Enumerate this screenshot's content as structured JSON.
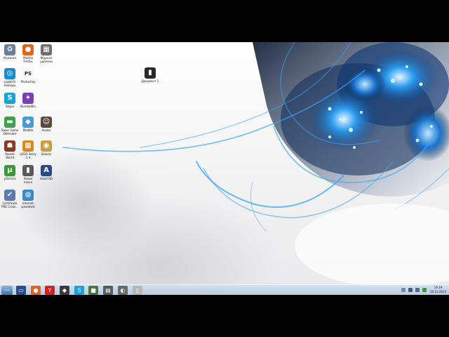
{
  "desktop": {
    "icons": [
      {
        "name": "icon-1-1",
        "label": "Корзина",
        "color": "#6a7fa0",
        "glyph": "♻"
      },
      {
        "name": "icon-1-2",
        "label": "Mozilla Firefox",
        "color": "#e0641e",
        "glyph": "●"
      },
      {
        "name": "icon-1-3",
        "label": "Журнал удалени",
        "color": "#6e6e6e",
        "glyph": "▦"
      },
      {
        "name": "icon-2-1",
        "label": "Logitech Камеры",
        "color": "#1a8ad6",
        "glyph": "◎"
      },
      {
        "name": "icon-2-2",
        "label": "Photoshop",
        "color": "#ffffff",
        "glyph": "PS"
      },
      {
        "name": "icon-3-1",
        "label": "Skype",
        "color": "#1aa1e0",
        "glyph": "S"
      },
      {
        "name": "icon-3-2",
        "label": "NumbaWin",
        "color": "#7a3fb5",
        "glyph": "✦"
      },
      {
        "name": "icon-4-1",
        "label": "Tower Game Defender",
        "color": "#3fa04a",
        "glyph": "▬"
      },
      {
        "name": "icon-4-2",
        "label": "ModMe",
        "color": "#4a9ad6",
        "glyph": "◆"
      },
      {
        "name": "icon-4-3",
        "label": "Avatar",
        "color": "#5a4a3a",
        "glyph": "☺"
      },
      {
        "name": "icon-5-1",
        "label": "Rocket World",
        "color": "#8a3a20",
        "glyph": "☗"
      },
      {
        "name": "icon-5-2",
        "label": "LEGO Harry 1-4",
        "color": "#d88a18",
        "glyph": "▩"
      },
      {
        "name": "icon-5-3",
        "label": "Selectu",
        "color": "#c8a040",
        "glyph": "◉"
      },
      {
        "name": "icon-6-1",
        "label": "µTorrent",
        "color": "#3a9a3a",
        "glyph": "µ"
      },
      {
        "name": "icon-6-2",
        "label": "Новая папка",
        "color": "#5a5a5a",
        "glyph": "▮"
      },
      {
        "name": "icon-6-3",
        "label": "AutoCAD",
        "color": "#2a4a8a",
        "glyph": "A"
      },
      {
        "name": "icon-7-1",
        "label": "Certificate PRE Creat...",
        "color": "#5a7ab0",
        "glyph": "✔"
      },
      {
        "name": "icon-7-2",
        "label": "Internet speedtest",
        "color": "#3a8ac8",
        "glyph": "◍"
      },
      {
        "name": "icon-file",
        "label": "Документ 1",
        "color": "#2a2a2a",
        "glyph": "▮"
      }
    ]
  },
  "taskbar": {
    "start_label": "Пуск",
    "items": [
      {
        "name": "taskbar-monitor",
        "color": "#2a4a8a",
        "glyph": "▭"
      },
      {
        "name": "taskbar-firefox",
        "color": "#e0641e",
        "glyph": "●"
      },
      {
        "name": "taskbar-yandex",
        "color": "#d42020",
        "glyph": "Y"
      },
      {
        "name": "taskbar-game",
        "color": "#3a3a3a",
        "glyph": "◆"
      },
      {
        "name": "taskbar-skype",
        "color": "#1aa1e0",
        "glyph": "S"
      },
      {
        "name": "taskbar-minecraft",
        "color": "#4a7a3a",
        "glyph": "■"
      },
      {
        "name": "taskbar-archive",
        "color": "#5a5a5a",
        "glyph": "▤"
      },
      {
        "name": "taskbar-photo",
        "color": "#6a6a6a",
        "glyph": "◐"
      },
      {
        "name": "taskbar-file",
        "color": "#b8b8b8",
        "glyph": "▯"
      }
    ],
    "tray": {
      "time": "19:19",
      "date": "20.12.2013"
    }
  }
}
